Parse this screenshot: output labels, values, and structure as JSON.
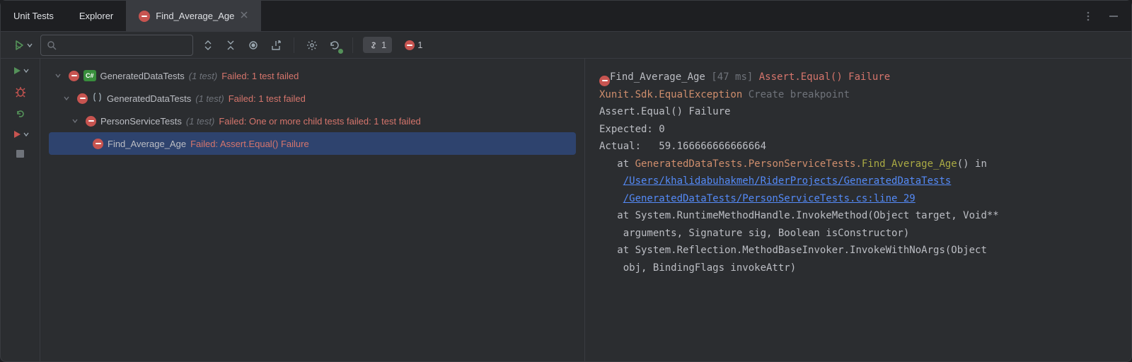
{
  "tabs": {
    "unit_tests": "Unit Tests",
    "explorer": "Explorer",
    "active": {
      "label": "Find_Average_Age"
    }
  },
  "toolbar": {
    "linked_count": "1",
    "failed_count": "1"
  },
  "tree": {
    "root": {
      "name": "GeneratedDataTests",
      "count": "(1 test)",
      "status": "Failed: 1 test failed"
    },
    "ns": {
      "name": "GeneratedDataTests",
      "count": "(1 test)",
      "status": "Failed: 1 test failed"
    },
    "cls": {
      "name": "PersonServiceTests",
      "count": "(1 test)",
      "status": "Failed: One or more child tests failed: 1 test failed"
    },
    "test": {
      "name": "Find_Average_Age",
      "status": "Failed: Assert.Equal() Failure"
    }
  },
  "details": {
    "header": {
      "name": "Find_Average_Age",
      "time": "[47 ms]",
      "fail": "Assert.Equal() Failure"
    },
    "exception": "Xunit.Sdk.EqualException",
    "breakpoint_hint": "Create breakpoint",
    "line1": "Assert.Equal() Failure",
    "line2_label": "Expected: ",
    "line2_val": "0",
    "line3_label": "Actual:   ",
    "line3_val": "59.166666666666664",
    "at_prefix": "   at ",
    "frame1_a": "GeneratedDataTests.PersonServiceTests.",
    "frame1_b": "Find_Average_Age",
    "frame1_c": "() in ",
    "link1": "/Users/khalidabuhakmeh/RiderProjects/GeneratedDataTests",
    "link2": "/GeneratedDataTests/PersonServiceTests.cs:line 29",
    "frame2": "System.RuntimeMethodHandle.InvokeMethod(Object target, Void**",
    "frame2b": "    arguments, Signature sig, Boolean isConstructor)",
    "frame3": "System.Reflection.MethodBaseInvoker.InvokeWithNoArgs(Object",
    "frame3b": "    obj, BindingFlags invokeAttr)"
  }
}
